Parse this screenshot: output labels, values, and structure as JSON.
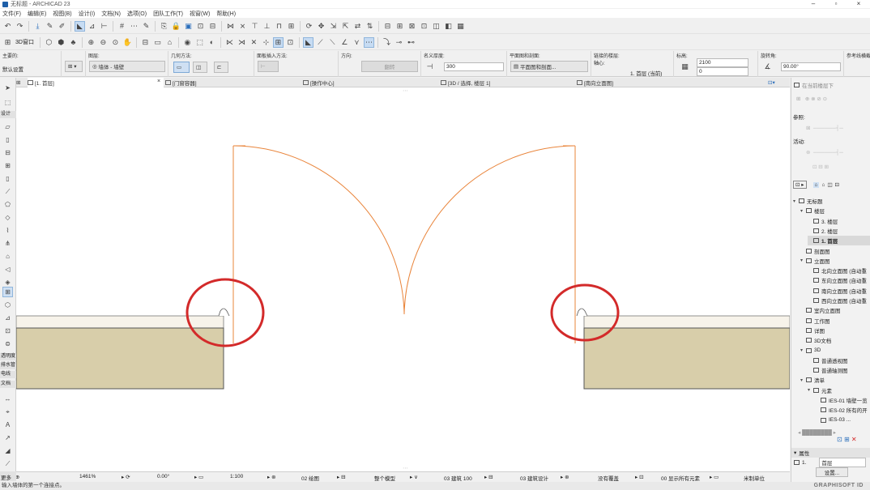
{
  "window": {
    "title": "无标题 - ARCHICAD 23"
  },
  "menu": [
    "文件(F)",
    "编辑(E)",
    "视图(B)",
    "设计(I)",
    "文档(N)",
    "选项(O)",
    "团队工作(T)",
    "视窗(W)",
    "帮助(H)"
  ],
  "toolbar2": {
    "view_3d_label": "3D窗口"
  },
  "infobox": {
    "main_label": "主要的:",
    "main_value": "默认设置",
    "layer_label": "图层:",
    "layer_value": "墙体 - 墙壁",
    "geometry_label": "几何方法:",
    "reference_label": "面板插入方法:",
    "orient_label": "方向:",
    "orient_button": "翻转",
    "width_label": "名义厚度:",
    "width_value": "300",
    "plan_label": "平面图和剖面:",
    "plan_button": "平面图和剖面...",
    "story_label": "链接的楼层:",
    "anchor_label": "轴心:",
    "story_value": "1. 首层 (当前)",
    "size_label": "标高:",
    "size_value1": "2100",
    "size_value2": "0",
    "angle_label": "旋转角:",
    "angle_value": "90.00°",
    "ref_label": "参考线横截面"
  },
  "tabs": {
    "tab1": "[1. 首层]",
    "tab2": "[门窗容器]",
    "tab3": "[操作中心]",
    "tab4": "[3D / 选择, 楼层 1]",
    "tab5": "[南向立面图]"
  },
  "toolbox": {
    "design_label": "设计",
    "doc_labels": [
      "透明度",
      "排水管",
      "电线",
      "文档"
    ],
    "more_label": "更多"
  },
  "navigator": {
    "header": "在当前楼层下",
    "ref_label": "参照:",
    "active_label": "活动:",
    "tree": [
      {
        "label": "无标题",
        "level": 0,
        "icon": "project-icon",
        "tri": "▾"
      },
      {
        "label": "楼层",
        "level": 1,
        "icon": "folder-icon",
        "tri": "▾"
      },
      {
        "label": "3. 楼层",
        "level": 2,
        "icon": "story-icon",
        "tri": ""
      },
      {
        "label": "2. 楼层",
        "level": 2,
        "icon": "story-icon",
        "tri": ""
      },
      {
        "label": "1. 首层",
        "level": 2,
        "icon": "story-icon",
        "tri": "",
        "selected": true
      },
      {
        "label": "剖面图",
        "level": 1,
        "icon": "section-icon",
        "tri": ""
      },
      {
        "label": "立面图",
        "level": 1,
        "icon": "folder-icon",
        "tri": "▾"
      },
      {
        "label": "北向立面图 (自动重",
        "level": 2,
        "icon": "elevation-icon",
        "tri": ""
      },
      {
        "label": "东向立面图 (自动重",
        "level": 2,
        "icon": "elevation-icon",
        "tri": ""
      },
      {
        "label": "南向立面图 (自动重",
        "level": 2,
        "icon": "elevation-icon",
        "tri": ""
      },
      {
        "label": "西向立面图 (自动重",
        "level": 2,
        "icon": "elevation-icon",
        "tri": ""
      },
      {
        "label": "室内立面图",
        "level": 1,
        "icon": "interior-icon",
        "tri": ""
      },
      {
        "label": "工作图",
        "level": 1,
        "icon": "worksheet-icon",
        "tri": ""
      },
      {
        "label": "详图",
        "level": 1,
        "icon": "detail-icon",
        "tri": ""
      },
      {
        "label": "3D文档",
        "level": 1,
        "icon": "3d-doc-icon",
        "tri": ""
      },
      {
        "label": "3D",
        "level": 1,
        "icon": "3d-icon",
        "tri": "▾"
      },
      {
        "label": "普通透视图",
        "level": 2,
        "icon": "perspective-icon",
        "tri": ""
      },
      {
        "label": "普通轴测图",
        "level": 2,
        "icon": "axonometry-icon",
        "tri": ""
      },
      {
        "label": "清单",
        "level": 1,
        "icon": "schedule-icon",
        "tri": "▾"
      },
      {
        "label": "元素",
        "level": 2,
        "icon": "folder-icon",
        "tri": "▾"
      },
      {
        "label": "IES-01 墙壁一览",
        "level": 3,
        "icon": "table-icon",
        "tri": ""
      },
      {
        "label": "IES-02 所有的开",
        "level": 3,
        "icon": "table-icon",
        "tri": ""
      },
      {
        "label": "IES-03 ...",
        "level": 3,
        "icon": "table-icon",
        "tri": ""
      }
    ],
    "properties_label": "属性",
    "prop_id": "1.",
    "prop_value": "首层",
    "settings_button": "设置..."
  },
  "statusbar": {
    "zoom": "1461%",
    "angle": "0.00°",
    "scale": "1:100",
    "layer_combo": "02 绘图",
    "model_view": "整个模型",
    "pen_set": "03 建筑 100",
    "mvo": "03 建筑设计",
    "override": "没有覆盖",
    "renovation": "00 显示所有元素",
    "dim": "米制单位"
  },
  "hint": "输入墙体的第一个连接点。",
  "brand": "GRAPHISOFT ID",
  "colors": {
    "door_stroke": "#e9843a",
    "wall_fill": "#d8ceaa",
    "wall_top": "#f7f3ea",
    "highlight": "#d32a2a",
    "accent": "#2a6ebb"
  }
}
